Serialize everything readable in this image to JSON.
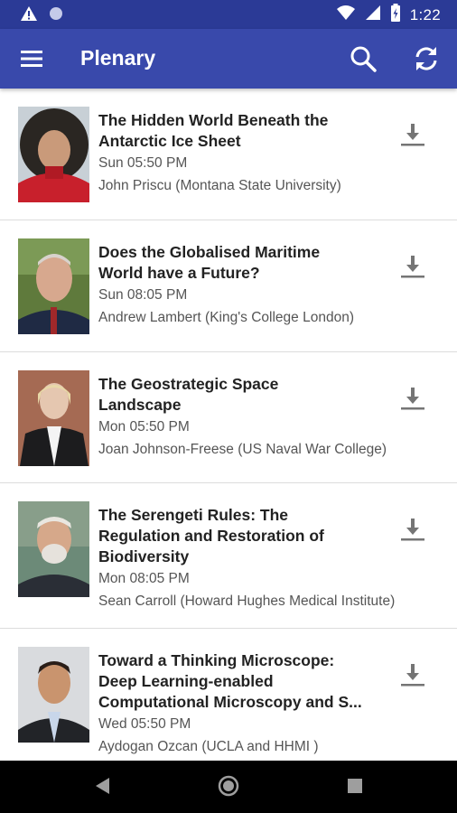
{
  "status_bar": {
    "time": "1:22",
    "icons": [
      "warning-icon",
      "dot-icon",
      "wifi-icon",
      "signal-icon",
      "battery-icon"
    ]
  },
  "app_bar": {
    "title": "Plenary",
    "icons": [
      "menu-icon",
      "search-icon",
      "refresh-icon"
    ]
  },
  "sessions": [
    {
      "title_lines": [
        "The Hidden World Beneath the",
        "Antarctic Ice Sheet"
      ],
      "time": "Sun 05:50 PM",
      "speaker": "John Priscu (Montana State University)"
    },
    {
      "title_lines": [
        "Does the Globalised Maritime",
        "World have a Future?"
      ],
      "time": "Sun 08:05 PM",
      "speaker": "Andrew Lambert (King's College London)"
    },
    {
      "title_lines": [
        "The Geostrategic Space",
        "Landscape"
      ],
      "time": "Mon 05:50 PM",
      "speaker": "Joan Johnson-Freese (US Naval War College)"
    },
    {
      "title_lines": [
        "The Serengeti Rules: The",
        "Regulation and Restoration of",
        "Biodiversity"
      ],
      "time": "Mon 08:05 PM",
      "speaker": "Sean Carroll (Howard Hughes Medical Institute)"
    },
    {
      "title_lines": [
        "Toward a Thinking Microscope:",
        "Deep Learning-enabled",
        "Computational Microscopy and S..."
      ],
      "time": "Wed 05:50 PM",
      "speaker": "Aydogan Ozcan (UCLA and HHMI )"
    }
  ],
  "nav_bar": {
    "icons": [
      "back-icon",
      "home-icon",
      "recents-icon"
    ]
  },
  "colors": {
    "status_bar": "#2b3a96",
    "app_bar": "#3949ab",
    "title_text": "#222222",
    "meta_text": "#555555",
    "download_icon": "#757575"
  }
}
